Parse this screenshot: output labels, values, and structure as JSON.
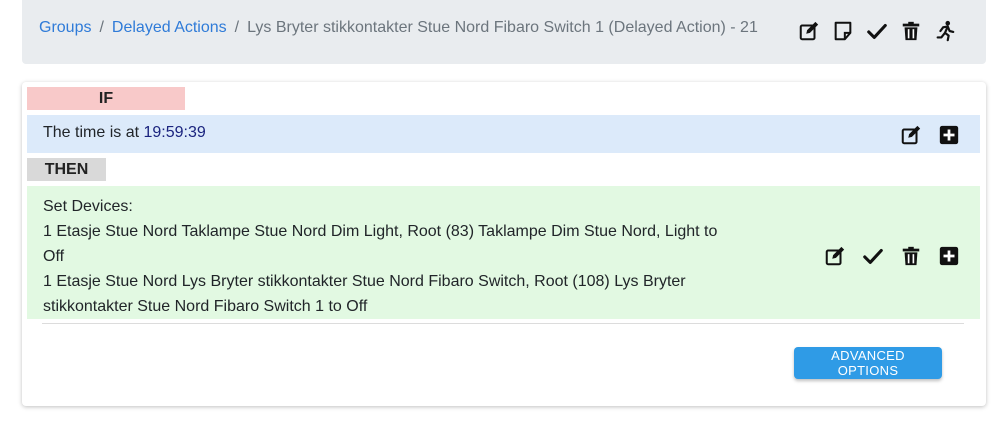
{
  "breadcrumb": {
    "items": [
      "Groups",
      "Delayed Actions"
    ],
    "separator": "/",
    "current": "Lys Bryter stikkontakter Stue Nord Fibaro Switch 1 (Delayed Action) - 21"
  },
  "header_actions": [
    "edit-icon",
    "note-icon",
    "check-icon",
    "trash-icon",
    "run-icon"
  ],
  "if_block": {
    "label": "IF",
    "text": "The time is at ",
    "time": "19:59:39",
    "actions": [
      "edit-icon",
      "plus-icon"
    ]
  },
  "then_block": {
    "label": "THEN",
    "lines": [
      "Set Devices:",
      "1 Etasje Stue Nord Taklampe Stue Nord Dim Light, Root (83) Taklampe Dim Stue Nord, Light to Off",
      "1 Etasje Stue Nord Lys Bryter stikkontakter Stue Nord Fibaro Switch, Root (108) Lys Bryter stikkontakter Stue Nord Fibaro Switch 1 to Off"
    ],
    "actions": [
      "edit-icon",
      "check-icon",
      "trash-icon",
      "plus-icon"
    ]
  },
  "advanced_options_label": "ADVANCED OPTIONS",
  "colors": {
    "link": "#2f7bd8",
    "if_label_bg": "#f8c9c9",
    "if_row_bg": "#dceafa",
    "then_label_bg": "#d9d9d9",
    "then_row_bg": "#e2f9e2",
    "button_bg": "#2f9be6"
  }
}
